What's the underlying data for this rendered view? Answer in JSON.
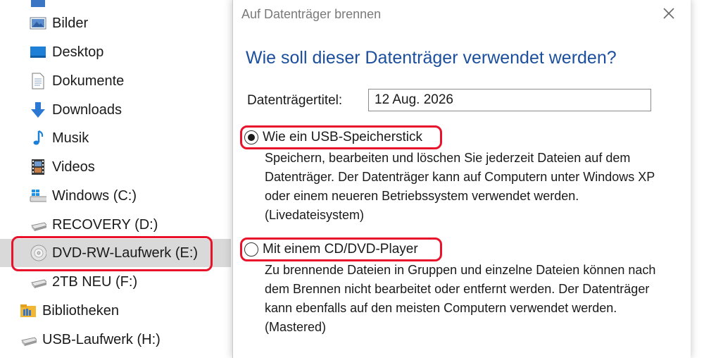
{
  "nav": {
    "items": [
      {
        "label": "Bilder",
        "icon": "pictures-icon"
      },
      {
        "label": "Desktop",
        "icon": "desktop-icon"
      },
      {
        "label": "Dokumente",
        "icon": "documents-icon"
      },
      {
        "label": "Downloads",
        "icon": "downloads-icon"
      },
      {
        "label": "Musik",
        "icon": "music-icon"
      },
      {
        "label": "Videos",
        "icon": "videos-icon"
      },
      {
        "label": "Windows (C:)",
        "icon": "windows-drive-icon"
      },
      {
        "label": "RECOVERY (D:)",
        "icon": "drive-icon"
      },
      {
        "label": "DVD-RW-Laufwerk (E:)",
        "icon": "dvd-drive-icon"
      },
      {
        "label": "2TB NEU (F:)",
        "icon": "drive-icon"
      },
      {
        "label": "Bibliotheken",
        "icon": "libraries-icon"
      },
      {
        "label": "USB-Laufwerk (H:)",
        "icon": "usb-drive-icon"
      }
    ]
  },
  "dialog": {
    "title": "Auf Datenträger brennen",
    "heading": "Wie soll dieser Datenträger verwendet werden?",
    "disc_title_label": "Datenträgertitel:",
    "disc_title_value": "12 Aug. 2026",
    "options": [
      {
        "label": "Wie ein USB-Speicherstick",
        "selected": true,
        "description": "Speichern, bearbeiten und löschen Sie jederzeit Dateien auf dem Datenträger. Der Datenträger kann auf Computern unter Windows XP oder einem neueren Betriebssystem verwendet werden. (Livedateisystem)"
      },
      {
        "label": "Mit einem CD/DVD-Player",
        "selected": false,
        "description": "Zu brennende Dateien in Gruppen und einzelne Dateien können nach dem Brennen nicht bearbeitet oder entfernt werden. Der Datenträger kann ebenfalls auf den meisten Computern verwendet werden. (Mastered)"
      }
    ]
  },
  "colors": {
    "heading": "#1b4f9c",
    "highlight": "#e8132a",
    "selected_row": "#d9d9d9"
  }
}
